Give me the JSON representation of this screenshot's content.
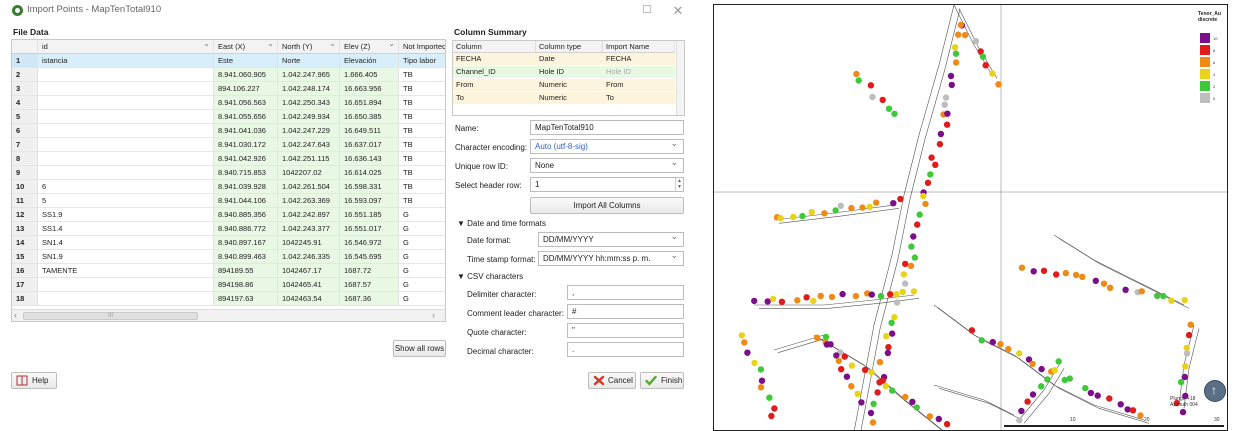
{
  "window": {
    "title": "Import Points - MapTenTotal910",
    "maximize_glyph": "☐",
    "close_glyph": "✕"
  },
  "file_data": {
    "label": "File Data",
    "columns": [
      {
        "name": "id"
      },
      {
        "name": "East (X)"
      },
      {
        "name": "North (Y)"
      },
      {
        "name": "Elev (Z)"
      },
      {
        "name": "Not Imported"
      }
    ],
    "rows": [
      {
        "num": "1",
        "c0": "istancia",
        "c1": "Este",
        "c2": "Norte",
        "c3": "Elevación",
        "c4": "Tipo labor",
        "selected": true
      },
      {
        "num": "2",
        "c0": "",
        "c1": "8.941.060.905",
        "c2": "1.042.247.965",
        "c3": "1.666.405",
        "c4": "TB"
      },
      {
        "num": "3",
        "c0": "",
        "c1": "894.106.227",
        "c2": "1.042.248.174",
        "c3": "16.663.956",
        "c4": "TB"
      },
      {
        "num": "4",
        "c0": "",
        "c1": "8.941.056.563",
        "c2": "1.042.250.343",
        "c3": "16.651.894",
        "c4": "TB"
      },
      {
        "num": "5",
        "c0": "",
        "c1": "8.941.055.656",
        "c2": "1.042.249.934",
        "c3": "16.650.385",
        "c4": "TB"
      },
      {
        "num": "6",
        "c0": "",
        "c1": "8.941.041.036",
        "c2": "1.042.247.229",
        "c3": "16.649.511",
        "c4": "TB"
      },
      {
        "num": "7",
        "c0": "",
        "c1": "8.941.030.172",
        "c2": "1.042.247.643",
        "c3": "16.637.017",
        "c4": "TB"
      },
      {
        "num": "8",
        "c0": "",
        "c1": "8.941.042.926",
        "c2": "1.042.251.115",
        "c3": "16.636.143",
        "c4": "TB"
      },
      {
        "num": "9",
        "c0": "",
        "c1": "8.940.715.853",
        "c2": "1042207.02",
        "c3": "16.614.025",
        "c4": "TB"
      },
      {
        "num": "10",
        "c0": "6",
        "c1": "8.941.039.928",
        "c2": "1.042.261.504",
        "c3": "16.598.331",
        "c4": "TB"
      },
      {
        "num": "11",
        "c0": "5",
        "c1": "8.941.044.106",
        "c2": "1.042.263.369",
        "c3": "16.593.097",
        "c4": "TB"
      },
      {
        "num": "12",
        "c0": "SS1.9",
        "c1": "8.940.885.356",
        "c2": "1.042.242.897",
        "c3": "16.551.185",
        "c4": "G"
      },
      {
        "num": "13",
        "c0": "SS1.4",
        "c1": "8.940.886.772",
        "c2": "1.042.243.377",
        "c3": "16.551.017",
        "c4": "G"
      },
      {
        "num": "14",
        "c0": "SN1.4",
        "c1": "8.940.897.167",
        "c2": "1042245.91",
        "c3": "16.546.972",
        "c4": "G"
      },
      {
        "num": "15",
        "c0": "SN1.9",
        "c1": "8.940.899.463",
        "c2": "1.042.246.335",
        "c3": "16.545.695",
        "c4": "G"
      },
      {
        "num": "16",
        "c0": "TAMENTE",
        "c1": "894189.55",
        "c2": "1042467.17",
        "c3": "1687.72",
        "c4": "G"
      },
      {
        "num": "17",
        "c0": "",
        "c1": "894198.86",
        "c2": "1042465.41",
        "c3": "1687.57",
        "c4": "G"
      },
      {
        "num": "18",
        "c0": "",
        "c1": "894197.63",
        "c2": "1042463.54",
        "c3": "1687.36",
        "c4": "G"
      }
    ],
    "scroll_left": "‹",
    "scroll_right": "›",
    "scroll_thumb": "III",
    "show_all_rows": "Show all rows"
  },
  "column_summary": {
    "label": "Column Summary",
    "headers": [
      "Column",
      "Column type",
      "Import Name"
    ],
    "rows": [
      {
        "column": "FECHA",
        "type": "Date",
        "import_name": "FECHA",
        "state": "data"
      },
      {
        "column": "Channel_ID",
        "type": "Hole ID",
        "import_name": "Hole ID",
        "state": "selected"
      },
      {
        "column": "From",
        "type": "Numeric",
        "import_name": "From",
        "state": "data"
      },
      {
        "column": "To",
        "type": "Numeric",
        "import_name": "To",
        "state": "data"
      }
    ]
  },
  "form": {
    "name_label": "Name:",
    "name_value": "MapTenTotal910",
    "encoding_label": "Character encoding:",
    "encoding_value": "Auto (utf-8-sig)",
    "unique_row_label": "Unique row ID:",
    "unique_row_value": "None",
    "header_row_label": "Select header row:",
    "header_row_value": "1",
    "import_all_columns": "Import All Columns",
    "date_time_section": "▼ Date and time formats",
    "date_format_label": "Date format:",
    "date_format_value": "DD/MM/YYYY",
    "timestamp_label": "Time stamp format:",
    "timestamp_value": "DD/MM/YYYY hh:mm:ss p. m.",
    "csv_section": "▼ CSV characters",
    "delimiter_label": "Delimiter character:",
    "delimiter_value": ",",
    "comment_label": "Comment leader character:",
    "comment_value": "#",
    "quote_label": "Quote character:",
    "quote_value": "\"",
    "decimal_label": "Decimal character:",
    "decimal_value": "."
  },
  "buttons": {
    "help": "Help",
    "cancel": "Cancel",
    "finish": "Finish"
  },
  "map": {
    "legend_title": "Tenor_Au discrete",
    "legend": [
      {
        "label": "10",
        "color": "#7b0f8a"
      },
      {
        "label": "8",
        "color": "#e01b1b"
      },
      {
        "label": "6",
        "color": "#f08a16"
      },
      {
        "label": "4",
        "color": "#e8d21a"
      },
      {
        "label": "2",
        "color": "#3fc93a"
      },
      {
        "label": "0",
        "color": "#bdbdbd"
      }
    ],
    "scale_text": "Plunge +18\nAzimuth 004",
    "scale_ticks": [
      "10",
      "20",
      "30"
    ]
  }
}
